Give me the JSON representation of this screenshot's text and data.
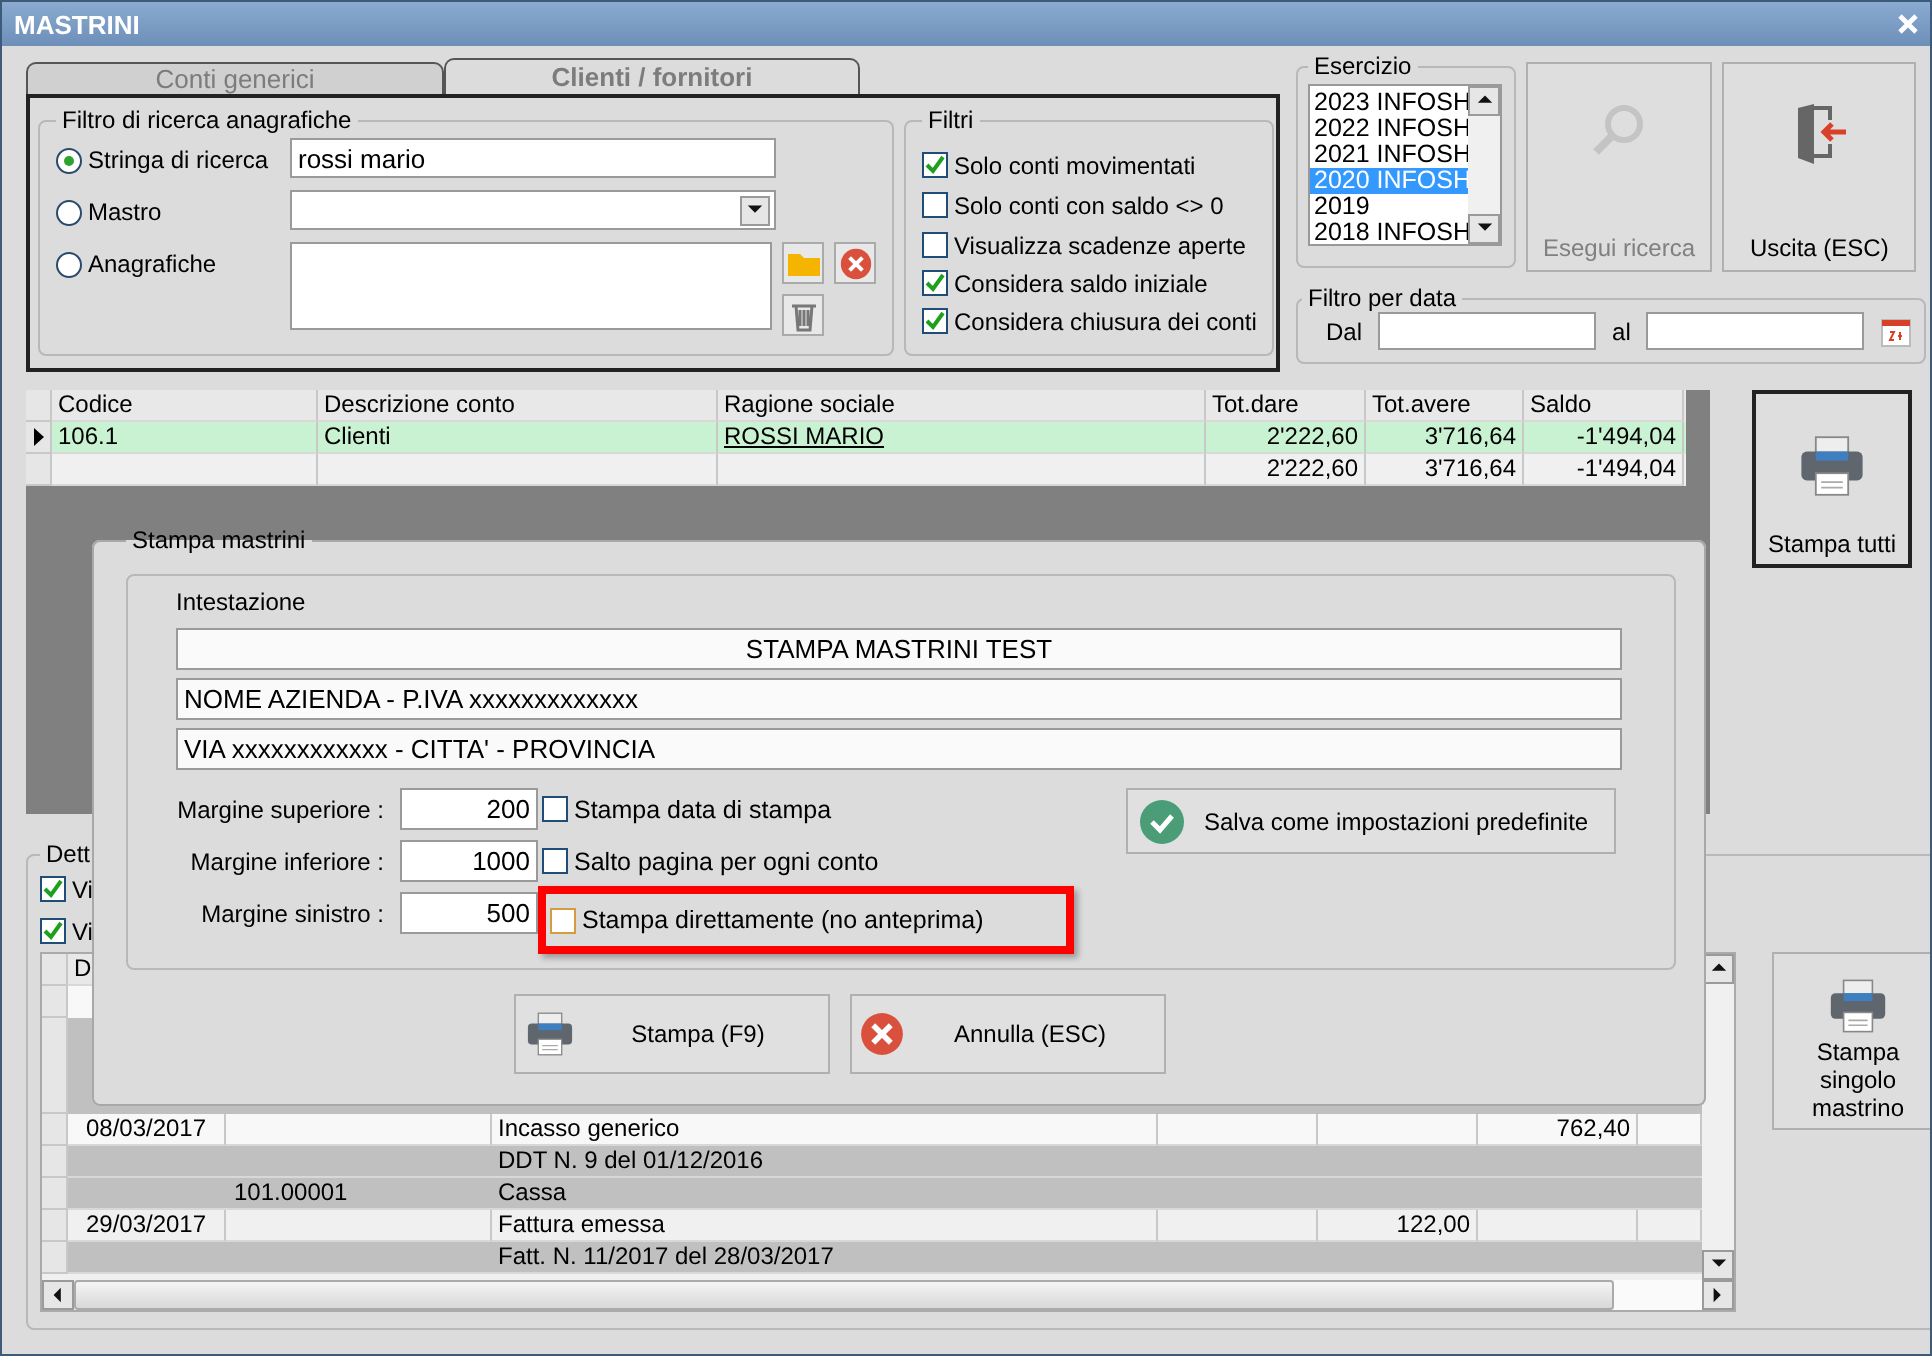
{
  "window": {
    "title": "MASTRINI"
  },
  "tabs": [
    {
      "label": "Conti generici",
      "selected": false
    },
    {
      "label": "Clienti / fornitori",
      "selected": true
    }
  ],
  "search_filter": {
    "title": "Filtro di ricerca anagrafiche",
    "options": [
      {
        "label": "Stringa di ricerca",
        "selected": true,
        "kind": "text",
        "value": "rossi mario"
      },
      {
        "label": "Mastro",
        "selected": false,
        "kind": "dropdown"
      },
      {
        "label": "Anagrafiche",
        "selected": false,
        "kind": "list"
      }
    ]
  },
  "filters": {
    "title": "Filtri",
    "items": [
      {
        "label": "Solo conti movimentati",
        "checked": true
      },
      {
        "label": "Solo conti con saldo <> 0",
        "checked": false
      },
      {
        "label": "Visualizza scadenze aperte",
        "checked": false
      },
      {
        "label": "Considera saldo iniziale",
        "checked": true
      },
      {
        "label": "Considera chiusura dei conti",
        "checked": true
      }
    ]
  },
  "esercizio": {
    "title": "Esercizio",
    "items": [
      {
        "label": "2023 INFOSH",
        "selected": false
      },
      {
        "label": "2022 INFOSH",
        "selected": false
      },
      {
        "label": "2021 INFOSH",
        "selected": false
      },
      {
        "label": "2020 INFOSH",
        "selected": true
      },
      {
        "label": "2019",
        "selected": false
      },
      {
        "label": "2018 INFOSH",
        "selected": false
      }
    ]
  },
  "search_button": {
    "label": "Esegui ricerca",
    "disabled": true
  },
  "exit_button": {
    "label": "Uscita (ESC)"
  },
  "date_filter": {
    "title": "Filtro per data",
    "from_label": "Dal",
    "to_label": "al"
  },
  "accounts_table": {
    "columns": [
      "Codice",
      "Descrizione conto",
      "Ragione sociale",
      "Tot.dare",
      "Tot.avere",
      "Saldo"
    ],
    "rows": [
      {
        "selected": true,
        "cells": [
          "106.1",
          "Clienti",
          "ROSSI MARIO",
          "2'222,60",
          "3'716,64",
          "-1'494,04"
        ]
      },
      {
        "selected": false,
        "cells": [
          "",
          "",
          "",
          "2'222,60",
          "3'716,64",
          "-1'494,04"
        ]
      }
    ]
  },
  "print_all_button": "Stampa tutti",
  "detail": {
    "title": "Dett",
    "checkboxes": [
      {
        "label": "Vi",
        "checked": true
      },
      {
        "label": "Vi",
        "checked": true
      }
    ],
    "columns": [
      "D"
    ],
    "rows": [
      {
        "kind": "entry",
        "cells": [
          "08/03/2017",
          "",
          "Incasso generico",
          "",
          "",
          "762,40",
          ""
        ]
      },
      {
        "kind": "note",
        "cells": [
          "",
          "",
          "DDT N. 9 del 01/12/2016",
          "",
          "",
          "",
          ""
        ]
      },
      {
        "kind": "note",
        "cells": [
          "",
          "101.00001",
          "Cassa",
          "",
          "",
          "",
          ""
        ]
      },
      {
        "kind": "entry",
        "cells": [
          "29/03/2017",
          "",
          "Fattura emessa",
          "",
          "122,00",
          "",
          ""
        ]
      },
      {
        "kind": "note",
        "cells": [
          "",
          "",
          "Fatt. N. 11/2017 del 28/03/2017",
          "",
          "",
          "",
          ""
        ]
      }
    ]
  },
  "print_single_button": "Stampa singolo mastrino",
  "dialog": {
    "title": "Stampa mastrini",
    "header_label": "Intestazione",
    "header_lines": [
      "STAMPA MASTRINI TEST",
      "NOME AZIENDA - P.IVA xxxxxxxxxxxxx",
      "VIA xxxxxxxxxxxx - CITTA' - PROVINCIA"
    ],
    "margins": [
      {
        "label": "Margine superiore :",
        "value": "200"
      },
      {
        "label": "Margine inferiore :",
        "value": "1000"
      },
      {
        "label": "Margine sinistro :",
        "value": "500"
      }
    ],
    "options": [
      {
        "label": "Stampa data di stampa",
        "checked": false,
        "highlighted": false
      },
      {
        "label": "Salto pagina per ogni conto",
        "checked": false,
        "highlighted": false
      },
      {
        "label": "Stampa direttamente (no anteprima)",
        "checked": false,
        "highlighted": true
      }
    ],
    "save_button": "Salva come impostazioni predefinite",
    "print_button": "Stampa (F9)",
    "cancel_button": "Annulla (ESC)"
  }
}
